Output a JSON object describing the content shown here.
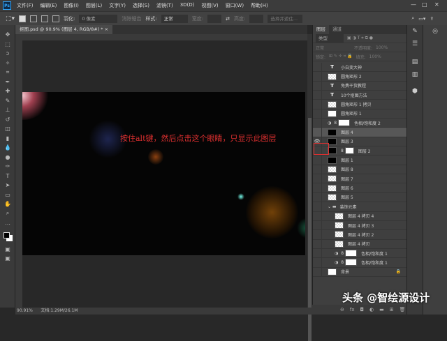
{
  "app": {
    "logo": "Ps"
  },
  "menu": [
    "文件(F)",
    "编辑(E)",
    "图像(I)",
    "图层(L)",
    "文字(Y)",
    "选择(S)",
    "滤镜(T)",
    "3D(D)",
    "视图(V)",
    "窗口(W)",
    "帮助(H)"
  ],
  "window_controls": {
    "minimize": "—",
    "maximize": "□",
    "close": "✕"
  },
  "options": {
    "feather_label": "羽化:",
    "feather_value": "0 像素",
    "antialias": "消除锯齿",
    "style_label": "样式:",
    "style_value": "正常",
    "width_label": "宽度:",
    "height_label": "高度:",
    "select_mask": "选择并遮住..."
  },
  "document_tab": {
    "title": "抠图.psd @ 90.9% (图层 4, RGB/8#) *",
    "close": "×"
  },
  "canvas": {
    "annotation": "按住alt键，然后点击这个眼睛，只显示此图层"
  },
  "status": {
    "zoom": "90.91%",
    "doc": "文档:1.29M/26.1M"
  },
  "layers_panel": {
    "tabs": [
      "图层",
      "通道"
    ],
    "filter_label": "类型",
    "blend_mode": "正常",
    "opacity_label": "不透明度:",
    "opacity_value": "100%",
    "lock_label": "锁定:",
    "fill_label": "填充:",
    "fill_value": "100%",
    "layers": [
      {
        "name": "小白变大神",
        "type": "text",
        "indent": 0
      },
      {
        "name": "圆角矩形 2",
        "type": "shape",
        "indent": 0
      },
      {
        "name": "免费干货教程",
        "type": "text",
        "indent": 0
      },
      {
        "name": "10个抠图方法",
        "type": "text",
        "indent": 0
      },
      {
        "name": "圆角矩形 1 拷贝",
        "type": "shape",
        "indent": 0
      },
      {
        "name": "圆角矩形 1",
        "type": "shapewhite",
        "indent": 0
      },
      {
        "name": "色相/饱和度 2",
        "type": "adjust",
        "indent": 0
      },
      {
        "name": "图层 4",
        "type": "black",
        "indent": 0,
        "selected": true
      },
      {
        "name": "图层 3",
        "type": "black",
        "indent": 0,
        "visible": true
      },
      {
        "name": "图层 2",
        "type": "blackmask",
        "indent": 0
      },
      {
        "name": "图层 1",
        "type": "black",
        "indent": 0
      },
      {
        "name": "图层 8",
        "type": "checker",
        "indent": 0
      },
      {
        "name": "图层 7",
        "type": "checker",
        "indent": 0
      },
      {
        "name": "图层 6",
        "type": "checker",
        "indent": 0
      },
      {
        "name": "图层 5",
        "type": "checker",
        "indent": 0
      },
      {
        "name": "装饰元素",
        "type": "group",
        "indent": 0
      },
      {
        "name": "图层 4 拷贝 4",
        "type": "shape",
        "indent": 1
      },
      {
        "name": "图层 4 拷贝 3",
        "type": "shape",
        "indent": 1
      },
      {
        "name": "图层 4 拷贝 2",
        "type": "shape",
        "indent": 1
      },
      {
        "name": "图层 4 拷贝",
        "type": "shape",
        "indent": 1
      },
      {
        "name": "色相/饱和度 1",
        "type": "adjust",
        "indent": 1
      },
      {
        "name": "色相/饱和度 1",
        "type": "adjust",
        "indent": 1
      },
      {
        "name": "背景",
        "type": "white",
        "indent": 0,
        "locked": true
      }
    ],
    "footer": [
      "⊖",
      "fx",
      "◘",
      "◐",
      "▬",
      "⊞",
      "🗑"
    ]
  },
  "watermark": "头条 @智绘源设计"
}
